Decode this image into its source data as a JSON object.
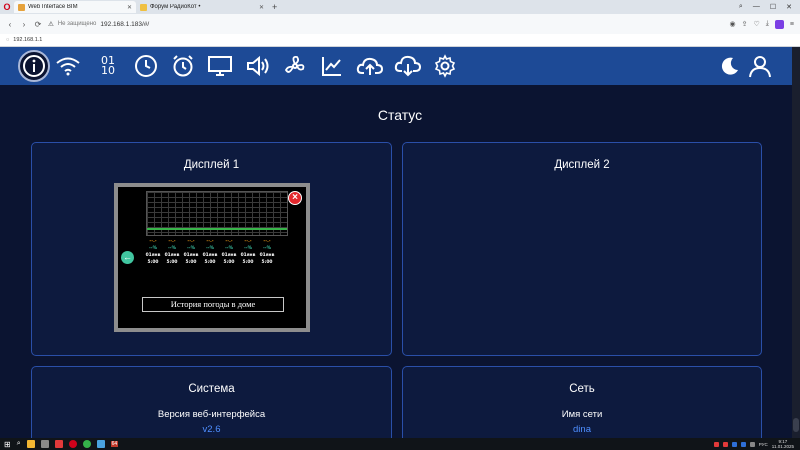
{
  "browser": {
    "tabs": [
      {
        "title": "Web Interface BIM",
        "active": true
      },
      {
        "title": "Форум РадиоКот •",
        "active": false
      }
    ],
    "new_tab": "+",
    "nav": {
      "back": "‹",
      "forward": "›",
      "reload": "⟳"
    },
    "url": {
      "security": "Не защищено",
      "address": "192.168.1.183/#/"
    },
    "status_url": "192.168.1.1"
  },
  "icons": {
    "nav": [
      "info-icon",
      "wifi-icon",
      "binary-icon",
      "clock-icon",
      "alarm-clock-icon",
      "monitor-icon",
      "speaker-icon",
      "fan-icon",
      "chart-line-icon",
      "cloud-upload-icon",
      "cloud-download-icon",
      "gear-icon"
    ],
    "right": [
      "moon-icon",
      "user-icon"
    ]
  },
  "app": {
    "binary_top": "01",
    "binary_bottom": "10",
    "page_title": "Статус",
    "display1": {
      "title": "Дисплей 1",
      "preview": {
        "columns": [
          {
            "top": "--.-",
            "mid": "--%",
            "date": "01янв",
            "time": "5:00"
          },
          {
            "top": "--.-",
            "mid": "--%",
            "date": "01янв",
            "time": "5:00"
          },
          {
            "top": "--.-",
            "mid": "--%",
            "date": "01янв",
            "time": "5:00"
          },
          {
            "top": "--.-",
            "mid": "--%",
            "date": "01янв",
            "time": "5:00"
          },
          {
            "top": "--.-",
            "mid": "--%",
            "date": "01янв",
            "time": "5:00"
          },
          {
            "top": "--.-",
            "mid": "--%",
            "date": "01янв",
            "time": "5:00"
          },
          {
            "top": "--.-",
            "mid": "--%",
            "date": "01янв",
            "time": "5:00"
          }
        ],
        "history_button": "История погоды в доме"
      }
    },
    "display2": {
      "title": "Дисплей 2"
    },
    "system": {
      "title": "Система",
      "label": "Версия веб-интерфейса",
      "value": "v2.6"
    },
    "network": {
      "title": "Сеть",
      "label": "Имя сети",
      "value": "dina"
    }
  },
  "colors": {
    "nav_bar": "#1d4a96",
    "page_bg": "#0b1431",
    "card_bg": "#0d1a3e",
    "card_border": "#2a4fa8",
    "value_text": "#4f8fff",
    "forecast_orange": "#f7a21b",
    "forecast_teal": "#3cc7a8"
  },
  "taskbar": {
    "time": "9:17",
    "date": "11.01.2025",
    "lang": "РУС",
    "pinned_badge": "64"
  }
}
